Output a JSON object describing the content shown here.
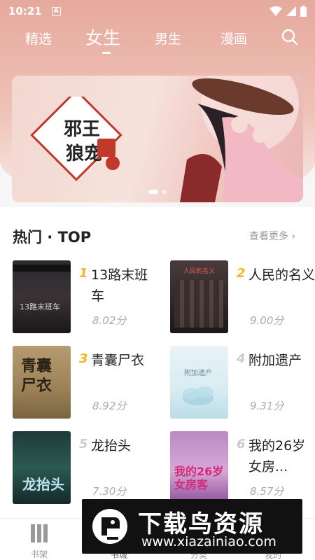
{
  "status_bar": {
    "time": "10:21",
    "a_icon": "A"
  },
  "nav": {
    "tabs": [
      {
        "label": "精选"
      },
      {
        "label": "女生"
      },
      {
        "label": "男生"
      },
      {
        "label": "漫画"
      }
    ],
    "active_tab": "女生"
  },
  "banner": {
    "cover_title": "邪王狼宠",
    "tag": "腹黑妻",
    "slides": 2
  },
  "section": {
    "title": "热门 · TOP",
    "more": "查看更多"
  },
  "books": [
    {
      "rank": "1",
      "title": "13路末班车",
      "score": "8.02分",
      "cover_text": "13路末班车"
    },
    {
      "rank": "2",
      "title": "人民的名义",
      "score": "9.00分",
      "cover_text": "人民的名义"
    },
    {
      "rank": "3",
      "title": "青囊尸衣",
      "score": "8.92分",
      "cover_text": "青囊尸衣"
    },
    {
      "rank": "4",
      "title": "附加遗产",
      "score": "9.31分",
      "cover_text": "附加遗产"
    },
    {
      "rank": "5",
      "title": "龙抬头",
      "score": "7.30分",
      "cover_text": "龙抬头"
    },
    {
      "rank": "6",
      "title": "我的26岁女房...",
      "score": "8.57分",
      "cover_text": "我的26岁女房客"
    }
  ],
  "rank_colors": {
    "top3": "#f2b622",
    "rest": "#cccccc"
  },
  "bottom_tabs": [
    {
      "label": "书架"
    },
    {
      "label": "书城"
    },
    {
      "label": "分类"
    },
    {
      "label": "我的"
    }
  ],
  "watermark": {
    "title": "下载鸟资源",
    "url": "www.xiazainiao.com"
  }
}
